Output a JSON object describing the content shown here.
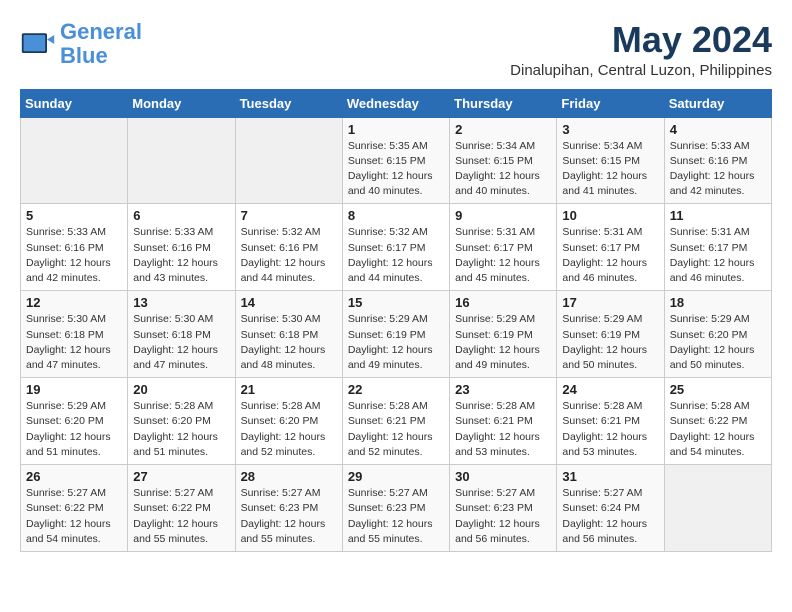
{
  "header": {
    "logo_line1": "General",
    "logo_line2": "Blue",
    "month_year": "May 2024",
    "location": "Dinalupihan, Central Luzon, Philippines"
  },
  "weekdays": [
    "Sunday",
    "Monday",
    "Tuesday",
    "Wednesday",
    "Thursday",
    "Friday",
    "Saturday"
  ],
  "weeks": [
    [
      {
        "day": "",
        "info": ""
      },
      {
        "day": "",
        "info": ""
      },
      {
        "day": "",
        "info": ""
      },
      {
        "day": "1",
        "info": "Sunrise: 5:35 AM\nSunset: 6:15 PM\nDaylight: 12 hours\nand 40 minutes."
      },
      {
        "day": "2",
        "info": "Sunrise: 5:34 AM\nSunset: 6:15 PM\nDaylight: 12 hours\nand 40 minutes."
      },
      {
        "day": "3",
        "info": "Sunrise: 5:34 AM\nSunset: 6:15 PM\nDaylight: 12 hours\nand 41 minutes."
      },
      {
        "day": "4",
        "info": "Sunrise: 5:33 AM\nSunset: 6:16 PM\nDaylight: 12 hours\nand 42 minutes."
      }
    ],
    [
      {
        "day": "5",
        "info": "Sunrise: 5:33 AM\nSunset: 6:16 PM\nDaylight: 12 hours\nand 42 minutes."
      },
      {
        "day": "6",
        "info": "Sunrise: 5:33 AM\nSunset: 6:16 PM\nDaylight: 12 hours\nand 43 minutes."
      },
      {
        "day": "7",
        "info": "Sunrise: 5:32 AM\nSunset: 6:16 PM\nDaylight: 12 hours\nand 44 minutes."
      },
      {
        "day": "8",
        "info": "Sunrise: 5:32 AM\nSunset: 6:17 PM\nDaylight: 12 hours\nand 44 minutes."
      },
      {
        "day": "9",
        "info": "Sunrise: 5:31 AM\nSunset: 6:17 PM\nDaylight: 12 hours\nand 45 minutes."
      },
      {
        "day": "10",
        "info": "Sunrise: 5:31 AM\nSunset: 6:17 PM\nDaylight: 12 hours\nand 46 minutes."
      },
      {
        "day": "11",
        "info": "Sunrise: 5:31 AM\nSunset: 6:17 PM\nDaylight: 12 hours\nand 46 minutes."
      }
    ],
    [
      {
        "day": "12",
        "info": "Sunrise: 5:30 AM\nSunset: 6:18 PM\nDaylight: 12 hours\nand 47 minutes."
      },
      {
        "day": "13",
        "info": "Sunrise: 5:30 AM\nSunset: 6:18 PM\nDaylight: 12 hours\nand 47 minutes."
      },
      {
        "day": "14",
        "info": "Sunrise: 5:30 AM\nSunset: 6:18 PM\nDaylight: 12 hours\nand 48 minutes."
      },
      {
        "day": "15",
        "info": "Sunrise: 5:29 AM\nSunset: 6:19 PM\nDaylight: 12 hours\nand 49 minutes."
      },
      {
        "day": "16",
        "info": "Sunrise: 5:29 AM\nSunset: 6:19 PM\nDaylight: 12 hours\nand 49 minutes."
      },
      {
        "day": "17",
        "info": "Sunrise: 5:29 AM\nSunset: 6:19 PM\nDaylight: 12 hours\nand 50 minutes."
      },
      {
        "day": "18",
        "info": "Sunrise: 5:29 AM\nSunset: 6:20 PM\nDaylight: 12 hours\nand 50 minutes."
      }
    ],
    [
      {
        "day": "19",
        "info": "Sunrise: 5:29 AM\nSunset: 6:20 PM\nDaylight: 12 hours\nand 51 minutes."
      },
      {
        "day": "20",
        "info": "Sunrise: 5:28 AM\nSunset: 6:20 PM\nDaylight: 12 hours\nand 51 minutes."
      },
      {
        "day": "21",
        "info": "Sunrise: 5:28 AM\nSunset: 6:20 PM\nDaylight: 12 hours\nand 52 minutes."
      },
      {
        "day": "22",
        "info": "Sunrise: 5:28 AM\nSunset: 6:21 PM\nDaylight: 12 hours\nand 52 minutes."
      },
      {
        "day": "23",
        "info": "Sunrise: 5:28 AM\nSunset: 6:21 PM\nDaylight: 12 hours\nand 53 minutes."
      },
      {
        "day": "24",
        "info": "Sunrise: 5:28 AM\nSunset: 6:21 PM\nDaylight: 12 hours\nand 53 minutes."
      },
      {
        "day": "25",
        "info": "Sunrise: 5:28 AM\nSunset: 6:22 PM\nDaylight: 12 hours\nand 54 minutes."
      }
    ],
    [
      {
        "day": "26",
        "info": "Sunrise: 5:27 AM\nSunset: 6:22 PM\nDaylight: 12 hours\nand 54 minutes."
      },
      {
        "day": "27",
        "info": "Sunrise: 5:27 AM\nSunset: 6:22 PM\nDaylight: 12 hours\nand 55 minutes."
      },
      {
        "day": "28",
        "info": "Sunrise: 5:27 AM\nSunset: 6:23 PM\nDaylight: 12 hours\nand 55 minutes."
      },
      {
        "day": "29",
        "info": "Sunrise: 5:27 AM\nSunset: 6:23 PM\nDaylight: 12 hours\nand 55 minutes."
      },
      {
        "day": "30",
        "info": "Sunrise: 5:27 AM\nSunset: 6:23 PM\nDaylight: 12 hours\nand 56 minutes."
      },
      {
        "day": "31",
        "info": "Sunrise: 5:27 AM\nSunset: 6:24 PM\nDaylight: 12 hours\nand 56 minutes."
      },
      {
        "day": "",
        "info": ""
      }
    ]
  ]
}
